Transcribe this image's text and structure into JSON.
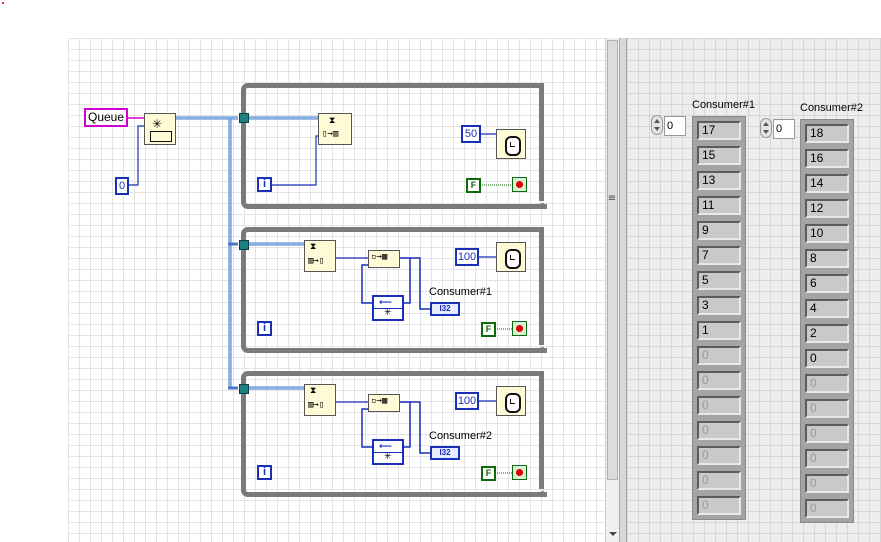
{
  "block_diagram": {
    "queue_label": "Queue",
    "queue_size_const": "0",
    "loop1": {
      "wait_ms": "50",
      "iter_label": "i",
      "stop_const": "F"
    },
    "loop2": {
      "wait_ms": "100",
      "iter_label": "i",
      "stop_const": "F",
      "indicator_label": "Consumer#1",
      "indicator_type": "I32"
    },
    "loop3": {
      "wait_ms": "100",
      "iter_label": "i",
      "stop_const": "F",
      "indicator_label": "Consumer#2",
      "indicator_type": "I32"
    },
    "icons": [
      "obtain-queue-icon",
      "enqueue-icon",
      "dequeue-icon",
      "build-array-icon",
      "wait-ms-icon",
      "stop-button-icon",
      "iteration-terminal-icon",
      "shift-register-icon"
    ]
  },
  "splitter_glyph": "≡",
  "front_panel": {
    "consumer1": {
      "label": "Consumer#1",
      "index": "0",
      "values": [
        "17",
        "15",
        "13",
        "11",
        "9",
        "7",
        "5",
        "3",
        "1",
        "0",
        "0",
        "0",
        "0",
        "0",
        "0",
        "0"
      ],
      "active_count": 9
    },
    "consumer2": {
      "label": "Consumer#2",
      "index": "0",
      "values": [
        "18",
        "16",
        "14",
        "12",
        "10",
        "8",
        "6",
        "4",
        "2",
        "0",
        "0",
        "0",
        "0",
        "0",
        "0",
        "0"
      ],
      "active_count": 10
    }
  },
  "colors": {
    "wire_queue": "#4a78c8",
    "wire_int": "#1a2fb8",
    "boolean": "#0b6b0b",
    "loop_frame": "#7a7a7a",
    "queue_refnum": "#d000d0"
  }
}
